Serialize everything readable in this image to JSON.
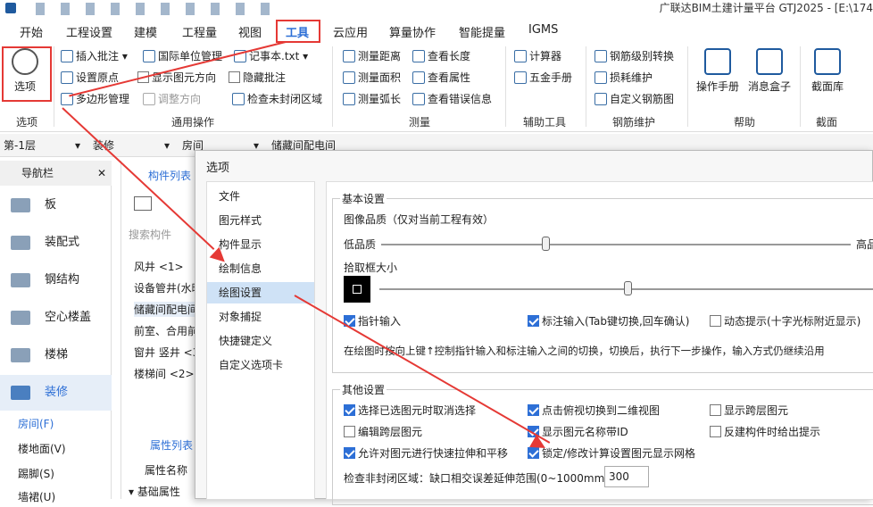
{
  "app_title": "广联达BIM土建计量平台 GTJ2025 - [E:\\174",
  "tabs": [
    "开始",
    "工程设置",
    "建模",
    "工程量",
    "视图",
    "工具",
    "云应用",
    "算量协作",
    "智能提量",
    "IGMS"
  ],
  "ribbon": {
    "options_btn": "选项",
    "options_group": "选项",
    "general_group": "通用操作",
    "general": [
      "插入批注",
      "国际单位管理",
      "记事本.txt",
      "设置原点",
      "显示图元方向",
      "隐藏批注",
      "多边形管理",
      "调整方向",
      "检查未封闭区域"
    ],
    "measure_group": "测量",
    "measure": [
      "测量距离",
      "查看长度",
      "测量面积",
      "查看属性",
      "测量弧长",
      "查看错误信息"
    ],
    "aux_group": "辅助工具",
    "aux": [
      "计算器",
      "五金手册"
    ],
    "rebar_group": "钢筋维护",
    "rebar": [
      "钢筋级别转换",
      "损耗维护",
      "自定义钢筋图"
    ],
    "help_group": "帮助",
    "help": [
      "操作手册",
      "消息盒子"
    ],
    "section_group": "截面",
    "section": [
      "截面库"
    ]
  },
  "floorbar": [
    "第-1层",
    "装修",
    "房间",
    "储藏间配电间"
  ],
  "nav": {
    "title": "导航栏",
    "items": [
      "板",
      "装配式",
      "钢结构",
      "空心楼盖",
      "楼梯",
      "装修"
    ],
    "sub": [
      "房间(F)",
      "楼地面(V)",
      "踢脚(S)",
      "墙裙(U)"
    ]
  },
  "component_list": {
    "title": "构件列表",
    "search": "搜索构件",
    "items": [
      "风井 <1>",
      "设备管井(水暖",
      "储藏间配电间",
      "前室、合用前",
      "窗井 竖井 <3",
      "楼梯间 <2>"
    ],
    "props_title": "属性列表",
    "props_header": "属性名称",
    "props_row": "基础属性"
  },
  "dialog": {
    "title": "选项",
    "menu": [
      "文件",
      "图元样式",
      "构件显示",
      "绘制信息",
      "绘图设置",
      "对象捕捉",
      "快捷键定义",
      "自定义选项卡"
    ],
    "active_index": 4,
    "basic": {
      "legend": "基本设置",
      "quality_label": "图像品质（仅对当前工程有效）",
      "low": "低品质",
      "high": "高品",
      "pick_label": "拾取框大小",
      "quality_value": 0.35,
      "pick_value": 0.5,
      "checks": [
        {
          "label": "指针输入",
          "on": true
        },
        {
          "label": "标注输入(Tab键切换,回车确认)",
          "on": true
        },
        {
          "label": "动态提示(十字光标附近显示)",
          "on": false
        }
      ],
      "desc": "在绘图时按向上键↑控制指针输入和标注输入之间的切换，切换后，执行下一步操作，输入方式仍继续沿用"
    },
    "other": {
      "legend": "其他设置",
      "checks": [
        {
          "label": "选择已选图元时取消选择",
          "on": true
        },
        {
          "label": "点击俯视切换到二维视图",
          "on": true
        },
        {
          "label": "显示跨层图元",
          "on": false
        },
        {
          "label": "编辑跨层图元",
          "on": false
        },
        {
          "label": "显示图元名称带ID",
          "on": true
        },
        {
          "label": "反建构件时给出提示",
          "on": false
        },
        {
          "label": "允许对图元进行快速拉伸和平移",
          "on": true
        },
        {
          "label": "锁定/修改计算设置图元显示网格",
          "on": true
        }
      ],
      "gap_label": "检查非封闭区域：缺口相交误差延伸范围(0~1000mm):",
      "gap_value": "300"
    }
  }
}
